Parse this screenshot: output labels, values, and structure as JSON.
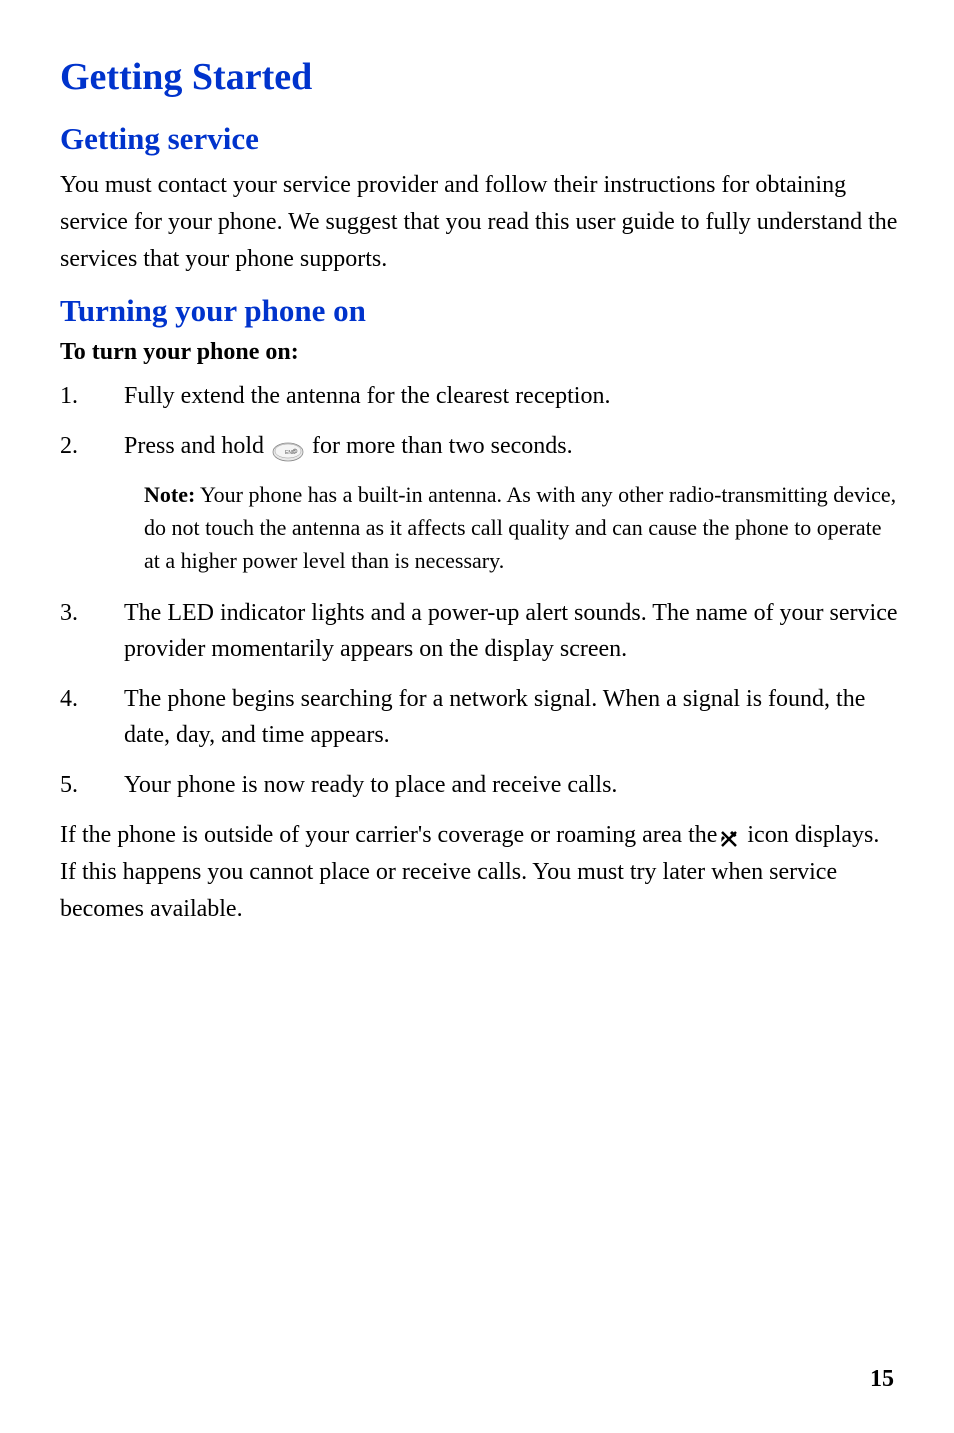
{
  "chapter_title": "Getting Started",
  "section1": {
    "title": "Getting service",
    "body": "You must contact your service provider and follow their instructions for obtaining service for your phone. We suggest that you read this user guide to fully understand the services that your phone supports."
  },
  "section2": {
    "title": "Turning your phone on",
    "sub_heading": "To turn your phone on:",
    "items": [
      {
        "num": "1.",
        "text": "Fully extend the antenna for the clearest reception."
      },
      {
        "num": "2.",
        "text_before": "Press and hold ",
        "text_after": " for more than two seconds."
      },
      {
        "num": "3.",
        "text": "The LED indicator lights and a power-up alert sounds. The name of your service provider momentarily appears on the display screen."
      },
      {
        "num": "4.",
        "text": "The phone begins searching for a network signal. When a signal is found, the date, day, and time appears."
      },
      {
        "num": "5.",
        "text": "Your phone is now ready to place and receive calls."
      }
    ],
    "note": {
      "label": "Note:",
      "text": " Your phone has a built-in antenna. As with any other radio-transmitting device, do not touch the antenna as it affects call quality and can cause the phone to operate at a higher power level than is necessary."
    },
    "closing": {
      "part1": "If the phone is outside of your carrier's coverage or roaming area the",
      "part2": "icon displays. If this happens you cannot place or receive calls. You must try later when service becomes available."
    }
  },
  "page_number": "15"
}
